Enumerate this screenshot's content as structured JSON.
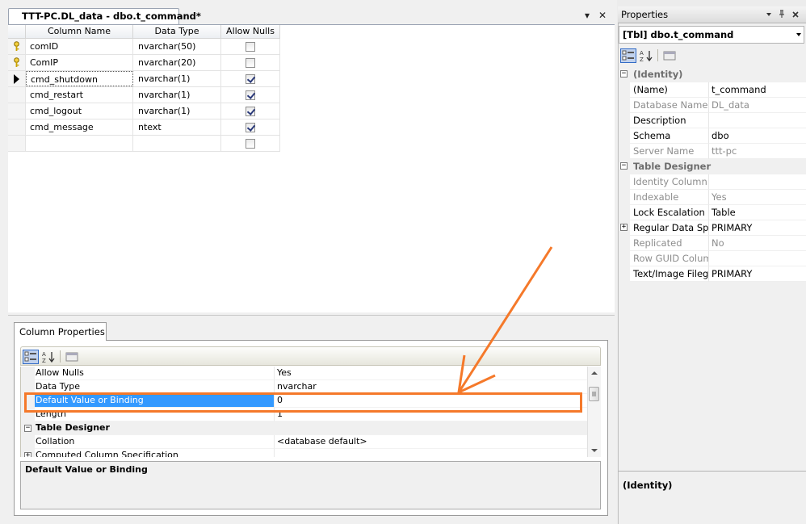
{
  "document": {
    "tab_title": "TTT-PC.DL_data - dbo.t_command*",
    "dropdown_glyph": "▾",
    "close_glyph": "✕"
  },
  "grid": {
    "headers": [
      "Column Name",
      "Data Type",
      "Allow Nulls"
    ],
    "rows": [
      {
        "name": "comID",
        "type": "nvarchar(50)",
        "allow_nulls": false,
        "indicator": "key-icon"
      },
      {
        "name": "ComIP",
        "type": "nvarchar(20)",
        "allow_nulls": false,
        "indicator": "key-icon"
      },
      {
        "name": "cmd_shutdown",
        "type": "nvarchar(1)",
        "allow_nulls": true,
        "indicator": "current-row-arrow"
      },
      {
        "name": "cmd_restart",
        "type": "nvarchar(1)",
        "allow_nulls": true,
        "indicator": ""
      },
      {
        "name": "cmd_logout",
        "type": "nvarchar(1)",
        "allow_nulls": true,
        "indicator": ""
      },
      {
        "name": "cmd_message",
        "type": "ntext",
        "allow_nulls": true,
        "indicator": ""
      },
      {
        "name": "",
        "type": "",
        "allow_nulls": false,
        "indicator": ""
      }
    ]
  },
  "column_properties": {
    "tab_label": "Column Properties",
    "rows": [
      {
        "name": "Allow Nulls",
        "value": "Yes"
      },
      {
        "name": "Data Type",
        "value": "nvarchar"
      },
      {
        "name": "Default Value or Binding",
        "value": "0"
      },
      {
        "name": "Length",
        "value": "1"
      }
    ],
    "category": "Table Designer",
    "category_rows": [
      {
        "name": "Collation",
        "value": "<database default>"
      },
      {
        "name": "Computed Column Specification",
        "value": ""
      }
    ],
    "description_title": "Default Value or Binding"
  },
  "properties": {
    "title": "Properties",
    "selected_object": "[Tbl] dbo.t_command",
    "categories": [
      {
        "name": "(Identity)",
        "rows": [
          {
            "name": "(Name)",
            "value": "t_command",
            "readonly": false
          },
          {
            "name": "Database Name",
            "value": "DL_data",
            "readonly": true
          },
          {
            "name": "Description",
            "value": "",
            "readonly": false
          },
          {
            "name": "Schema",
            "value": "dbo",
            "readonly": false
          },
          {
            "name": "Server Name",
            "value": "ttt-pc",
            "readonly": true
          }
        ]
      },
      {
        "name": "Table Designer",
        "rows": [
          {
            "name": "Identity Column",
            "value": "",
            "readonly": true
          },
          {
            "name": "Indexable",
            "value": "Yes",
            "readonly": true
          },
          {
            "name": "Lock Escalation",
            "value": "Table",
            "readonly": false
          },
          {
            "name": "Regular Data Spac",
            "value": "PRIMARY",
            "readonly": false,
            "expandable": true
          },
          {
            "name": "Replicated",
            "value": "No",
            "readonly": true
          },
          {
            "name": "Row GUID Colum",
            "value": "",
            "readonly": true
          },
          {
            "name": "Text/Image Filegr",
            "value": "PRIMARY",
            "readonly": false
          }
        ]
      }
    ],
    "description_title": "(Identity)"
  },
  "colors": {
    "highlight": "#f5792a",
    "selection": "#3399ff"
  }
}
